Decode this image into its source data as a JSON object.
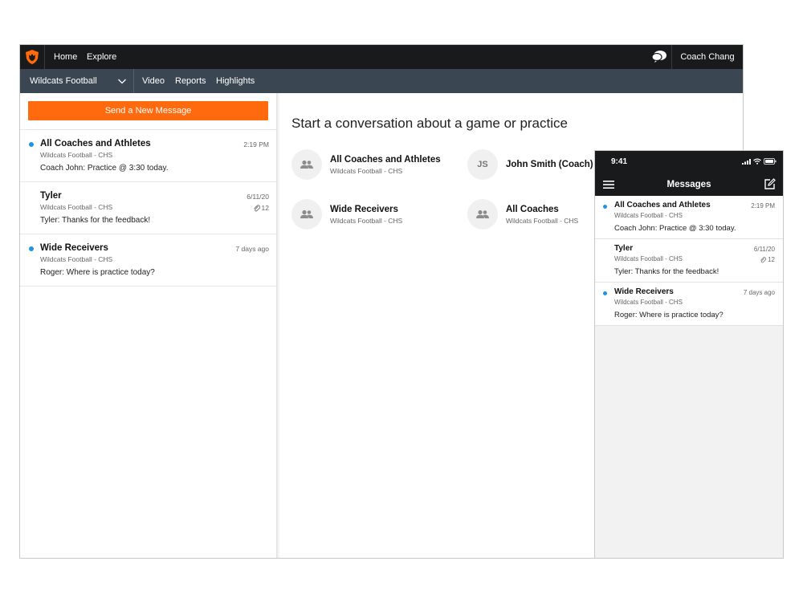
{
  "colors": {
    "accent": "#ff6a0e",
    "unread_dot": "#1a96e3",
    "topbar": "#191a1b",
    "subbar": "#3a4652"
  },
  "topbar": {
    "logo_icon": "wildcat-shield-logo-icon",
    "home_label": "Home",
    "explore_label": "Explore",
    "messages_icon": "chat-bubbles-icon",
    "user_name": "Coach Chang"
  },
  "subbar": {
    "team_name": "Wildcats Football",
    "dropdown_icon": "chevron-down-icon",
    "video_label": "Video",
    "reports_label": "Reports",
    "highlights_label": "Highlights"
  },
  "sidebar": {
    "send_button_label": "Send a New Message",
    "conversations": [
      {
        "title": "All Coaches and Athletes",
        "team": "Wildcats Football - CHS",
        "preview": "Coach John: Practice @ 3:30 today.",
        "time": "2:19 PM",
        "unread": true
      },
      {
        "title": "Tyler",
        "team": "Wildcats Football - CHS",
        "preview": "Tyler: Thanks for the feedback!",
        "time": "6/11/20",
        "attachments": "12",
        "unread": false
      },
      {
        "title": "Wide Receivers",
        "team": "Wildcats Football - CHS",
        "preview": "Roger: Where is practice today?",
        "time": "7 days ago",
        "unread": true
      }
    ]
  },
  "main": {
    "heading": "Start a conversation about a game or practice",
    "groups": [
      {
        "title": "All Coaches and Athletes",
        "team": "Wildcats Football - CHS",
        "icon": "group-icon"
      },
      {
        "title": "John Smith (Coach)",
        "initials": "JS"
      },
      {
        "title": "Wide Receivers",
        "team": "Wildcats Football - CHS",
        "icon": "group-icon"
      },
      {
        "title": "All Coaches",
        "team": "Wildcats Football - CHS",
        "icon": "group-icon"
      }
    ]
  },
  "phone": {
    "status_time": "9:41",
    "title": "Messages",
    "menu_icon": "hamburger-menu-icon",
    "compose_icon": "compose-icon",
    "conversations": [
      {
        "title": "All Coaches and Athletes",
        "team": "Wildcats Football - CHS",
        "preview": "Coach John: Practice @ 3:30 today.",
        "time": "2:19 PM",
        "unread": true
      },
      {
        "title": "Tyler",
        "team": "Wildcats Football - CHS",
        "preview": "Tyler: Thanks for the feedback!",
        "time": "6/11/20",
        "attachments": "12",
        "unread": false
      },
      {
        "title": "Wide Receivers",
        "team": "Wildcats Football - CHS",
        "preview": "Roger: Where is practice today?",
        "time": "7 days ago",
        "unread": true
      }
    ]
  }
}
